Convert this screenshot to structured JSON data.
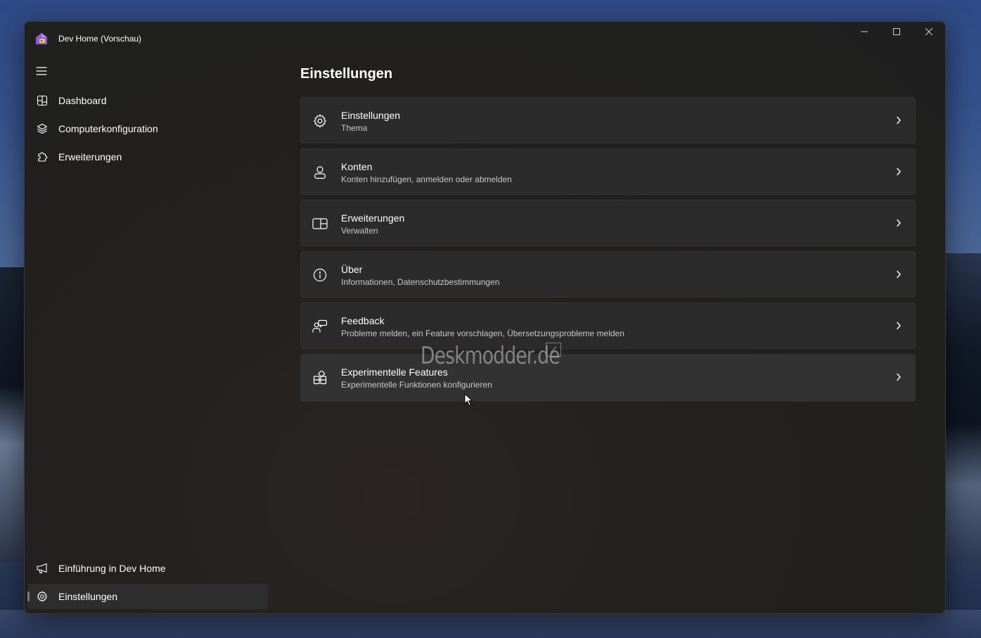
{
  "window": {
    "title": "Dev Home (Vorschau)"
  },
  "caption": {
    "minimize_icon": "minimize-icon",
    "maximize_icon": "maximize-icon",
    "close_icon": "close-icon"
  },
  "nav": {
    "top_items": [
      {
        "label": "Dashboard",
        "icon": "dashboard-icon"
      },
      {
        "label": "Computerkonfiguration",
        "icon": "layers-icon"
      },
      {
        "label": "Erweiterungen",
        "icon": "puzzle-icon"
      }
    ],
    "bottom_items": [
      {
        "label": "Einführung in Dev Home",
        "icon": "megaphone-icon"
      },
      {
        "label": "Einstellungen",
        "icon": "gear-icon",
        "selected": true
      }
    ]
  },
  "main": {
    "title": "Einstellungen",
    "cards": [
      {
        "title": "Einstellungen",
        "subtitle": "Thema",
        "icon": "gear-icon"
      },
      {
        "title": "Konten",
        "subtitle": "Konten hinzufügen, anmelden oder abmelden",
        "icon": "person-icon"
      },
      {
        "title": "Erweiterungen",
        "subtitle": "Verwalten",
        "icon": "extension-panel-icon"
      },
      {
        "title": "Über",
        "subtitle": "Informationen, Datenschutzbestimmungen",
        "icon": "info-icon"
      },
      {
        "title": "Feedback",
        "subtitle": "Probleme melden, ein Feature vorschlagen, Übersetzungsprobleme melden",
        "icon": "feedback-icon"
      },
      {
        "title": "Experimentelle Features",
        "subtitle": "Experimentelle Funktionen konfigurieren",
        "icon": "experimental-icon"
      }
    ]
  },
  "watermark": "Deskmodder.de",
  "colors": {
    "window_bg": "#202020",
    "card_bg": "#2b2b2b",
    "text": "#ffffff",
    "subtext": "#c8c8c8",
    "app_icon_purple": "#8a5cd8",
    "app_icon_yellow": "#f2c94c"
  }
}
